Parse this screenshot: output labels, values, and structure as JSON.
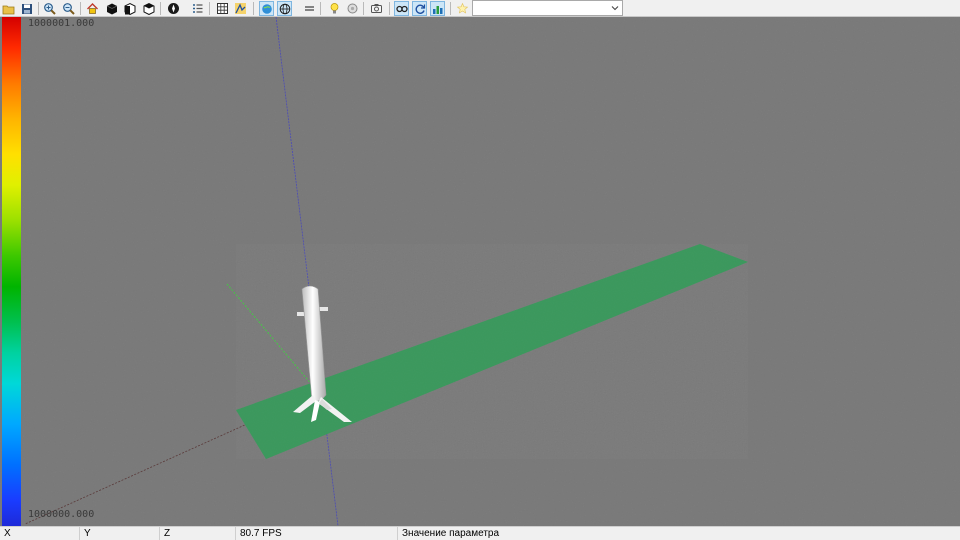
{
  "toolbar": {
    "buttons": [
      {
        "id": "open",
        "icon": "open-folder-icon"
      },
      {
        "id": "save",
        "icon": "save-icon"
      },
      {
        "id": "zoom-in",
        "icon": "zoom-in-icon"
      },
      {
        "id": "zoom-out",
        "icon": "zoom-out-icon"
      },
      {
        "id": "home",
        "icon": "home-view-icon"
      },
      {
        "id": "view-solid",
        "icon": "cube-solid-icon"
      },
      {
        "id": "view-front",
        "icon": "cube-front-icon"
      },
      {
        "id": "view-side",
        "icon": "cube-side-icon"
      },
      {
        "id": "compass",
        "icon": "compass-icon"
      },
      {
        "id": "list",
        "icon": "list-icon"
      },
      {
        "id": "grid",
        "icon": "grid-icon"
      },
      {
        "id": "shape",
        "icon": "shape-icon"
      },
      {
        "id": "globe-view",
        "icon": "globe-view-icon",
        "active": true
      },
      {
        "id": "globe",
        "icon": "globe-icon",
        "active": true
      },
      {
        "id": "lines",
        "icon": "lines-icon"
      },
      {
        "id": "light",
        "icon": "lightbulb-icon"
      },
      {
        "id": "material",
        "icon": "material-icon"
      },
      {
        "id": "camera",
        "icon": "camera-icon"
      },
      {
        "id": "link",
        "icon": "link-icon",
        "active": true
      },
      {
        "id": "refresh",
        "icon": "refresh-icon",
        "active": true
      },
      {
        "id": "chart",
        "icon": "chart-icon",
        "active": true
      },
      {
        "id": "star",
        "icon": "star-icon"
      }
    ],
    "parameter_select": {
      "value": ""
    }
  },
  "viewport": {
    "scale_max": "1000001.000",
    "scale_min": "1000000.000",
    "colors": {
      "background": "#7c7c7c",
      "strip": "#3d9a5f",
      "rocket": "#e8e8e8"
    }
  },
  "statusbar": {
    "x_label": "X",
    "y_label": "Y",
    "z_label": "Z",
    "fps": "80.7  FPS",
    "parameter": "Значение параметра"
  }
}
